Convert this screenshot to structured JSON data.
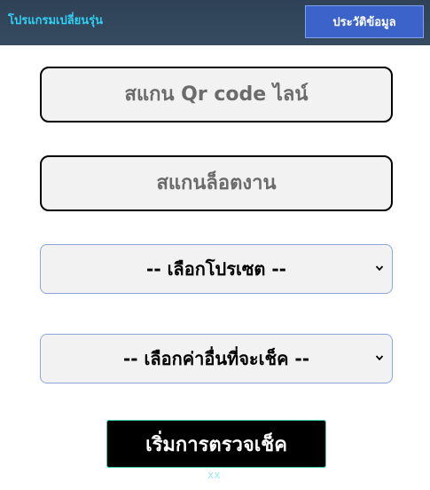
{
  "header": {
    "title": "โปรแกรมเปลี่ยนรุ่น",
    "history_button": "ประวัติข้อมูล"
  },
  "form": {
    "qr_line_placeholder": "สแกน Qr code ไลน์",
    "lot_placeholder": "สแกนล็อตงาน",
    "preset_select": {
      "selected": "-- เลือกโปรเซต --"
    },
    "other_select": {
      "selected": "-- เลือกค่าอื่นที่จะเช็ค --"
    },
    "start_button": "เริ่มการตรวจเช็ค"
  },
  "footer_text": "xx",
  "colors": {
    "header_bg": "#344759",
    "title_accent": "#2fd0f4",
    "history_button_bg": "#3b63c9",
    "field_bg": "#f2f2f2",
    "start_button_bg": "#000000"
  }
}
